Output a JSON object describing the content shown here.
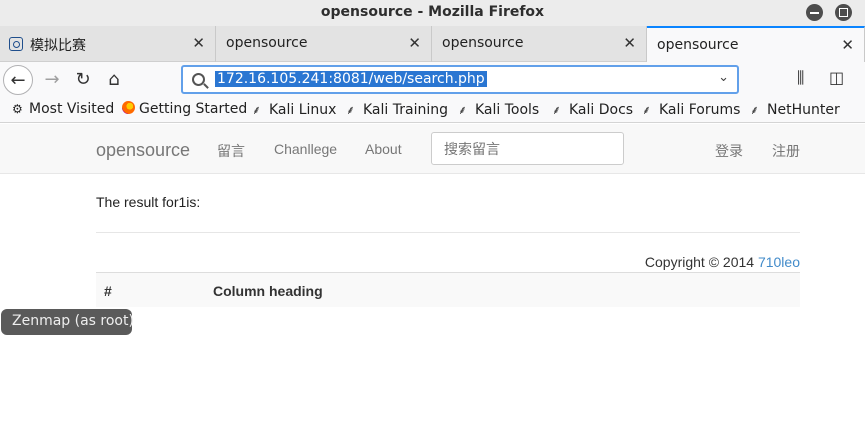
{
  "window": {
    "title": "opensource - Mozilla Firefox"
  },
  "tabs": [
    {
      "label": "模拟比赛"
    },
    {
      "label": "opensource"
    },
    {
      "label": "opensource"
    },
    {
      "label": "opensource"
    }
  ],
  "tab_close_glyph": "✕",
  "urlbar": {
    "url": "172.16.105.241:8081/web/search.php"
  },
  "bookmarks": [
    {
      "label": "Most Visited",
      "icon": "gear-icon"
    },
    {
      "label": "Getting Started",
      "icon": "firefox-icon"
    },
    {
      "label": "Kali Linux",
      "icon": "kali-icon"
    },
    {
      "label": "Kali Training",
      "icon": "kali-icon"
    },
    {
      "label": "Kali Tools",
      "icon": "kali-icon"
    },
    {
      "label": "Kali Docs",
      "icon": "kali-icon"
    },
    {
      "label": "Kali Forums",
      "icon": "kali-icon"
    },
    {
      "label": "NetHunter",
      "icon": "kali-icon"
    }
  ],
  "site": {
    "brand": "opensource",
    "nav": [
      "留言",
      "Chanllege",
      "About"
    ],
    "search_placeholder": "搜索留言",
    "login": "登录",
    "register": "注册",
    "result_text": "The result for1is:",
    "copyright_prefix": "Copyright © 2014",
    "copyright_link": "710leo",
    "table_headers": [
      "#",
      "Column heading"
    ]
  },
  "tooltip": "Zenmap (as root)",
  "colors": {
    "accent": "#0a84ff",
    "link": "#428bca",
    "url_highlight": "#2a76d2"
  }
}
